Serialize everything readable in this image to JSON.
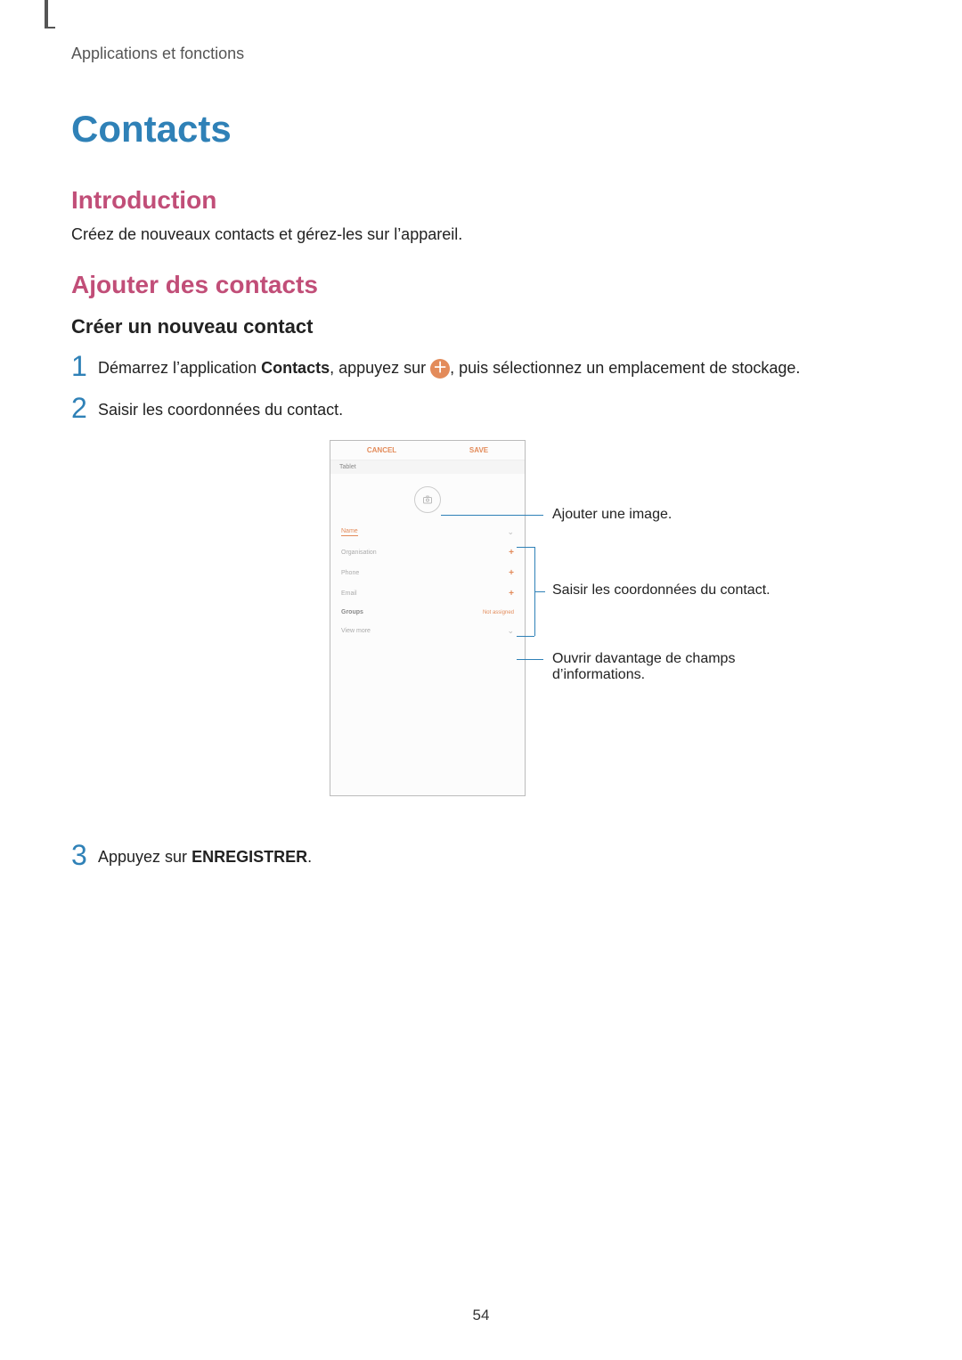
{
  "breadcrumb": "Applications et fonctions",
  "title": "Contacts",
  "sections": {
    "intro": {
      "heading": "Introduction",
      "body": "Créez de nouveaux contacts et gérez-les sur l’appareil."
    },
    "add": {
      "heading": "Ajouter des contacts",
      "sub": "Créer un nouveau contact"
    }
  },
  "steps": {
    "s1": {
      "num": "1",
      "pre": "Démarrez l’application ",
      "bold1": "Contacts",
      "mid": ", appuyez sur ",
      "post": ", puis sélectionnez un emplacement de stockage."
    },
    "s2": {
      "num": "2",
      "text": "Saisir les coordonnées du contact."
    },
    "s3": {
      "num": "3",
      "pre": "Appuyez sur ",
      "bold": "ENREGISTRER",
      "post": "."
    }
  },
  "mock": {
    "cancel": "CANCEL",
    "save": "SAVE",
    "tablet": "Tablet",
    "name": "Name",
    "org": "Organisation",
    "phone": "Phone",
    "email": "Email",
    "groups": "Groups",
    "not_assigned": "Not assigned",
    "view_more": "View more"
  },
  "callouts": {
    "image": "Ajouter une image.",
    "info": "Saisir les coordonnées du contact.",
    "more": "Ouvrir davantage de champs d’informations."
  },
  "page_number": "54"
}
